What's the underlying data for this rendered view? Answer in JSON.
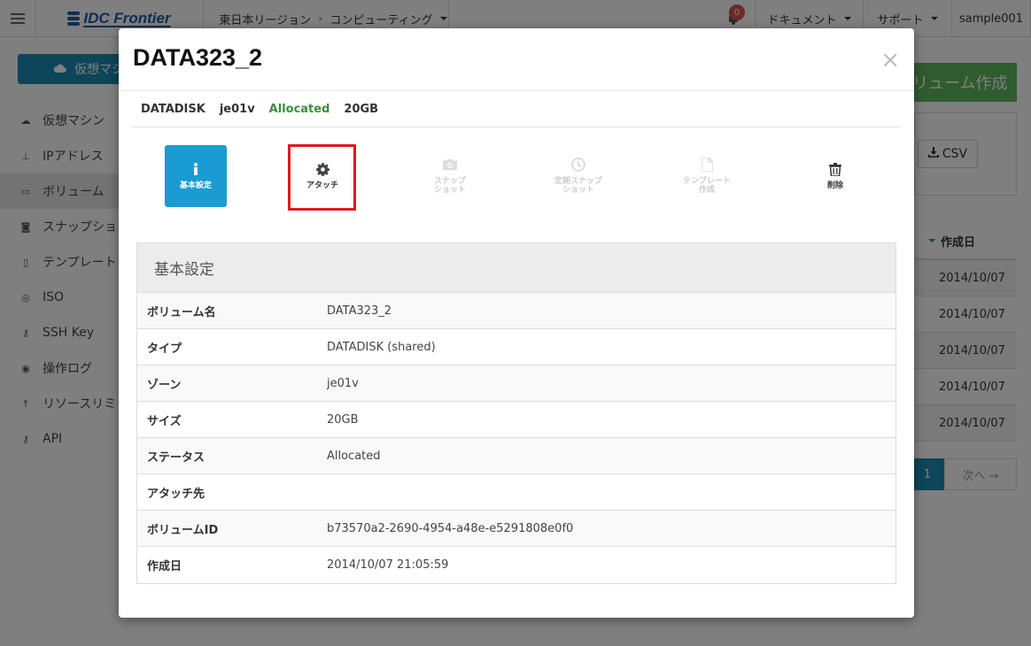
{
  "topbar": {
    "logo_text": "IDC Frontier",
    "region": "東日本リージョン",
    "region_sep": "›",
    "service": "コンピューティング",
    "notifications": "0",
    "docs": "ドキュメント",
    "support": "サポート",
    "user": "sample001"
  },
  "sidebar": {
    "vm_button": "仮想マシ",
    "items": [
      {
        "label": "仮想マシン",
        "icon": "cloud-icon"
      },
      {
        "label": "IPアドレス",
        "icon": "sitemap-icon"
      },
      {
        "label": "ボリューム",
        "icon": "hdd-icon"
      },
      {
        "label": "スナップショ",
        "icon": "camera-icon"
      },
      {
        "label": "テンプレート",
        "icon": "file-icon"
      },
      {
        "label": "ISO",
        "icon": "disc-icon"
      },
      {
        "label": "SSH Key",
        "icon": "key-icon"
      },
      {
        "label": "操作ログ",
        "icon": "eye-icon"
      },
      {
        "label": "リソースリミ",
        "icon": "arrow-up-icon"
      },
      {
        "label": "API",
        "icon": "key-icon"
      }
    ]
  },
  "background": {
    "create_button": "リューム作成",
    "csv_button": "CSV",
    "date_header": "作成日",
    "dates": [
      "2014/10/07",
      "2014/10/07",
      "2014/10/07",
      "2014/10/07",
      "2014/10/07"
    ],
    "page": "1",
    "next": "次へ →"
  },
  "modal": {
    "title": "DATA323_2",
    "close": "×",
    "summary": {
      "type": "DATADISK",
      "zone": "je01v",
      "status": "Allocated",
      "size": "20GB"
    },
    "actions": {
      "basic": "基本設定",
      "attach": "アタッチ",
      "snapshot": "スナップ\nショット",
      "scheduled_snapshot": "定期スナップ\nショット",
      "template": "テンプレート\n作成",
      "delete": "削除"
    },
    "panel_title": "基本設定",
    "details": [
      {
        "key": "ボリューム名",
        "value": "DATA323_2"
      },
      {
        "key": "タイプ",
        "value": "DATADISK (shared)"
      },
      {
        "key": "ゾーン",
        "value": "je01v"
      },
      {
        "key": "サイズ",
        "value": "20GB"
      },
      {
        "key": "ステータス",
        "value": "Allocated"
      },
      {
        "key": "アタッチ先",
        "value": ""
      },
      {
        "key": "ボリュームID",
        "value": "b73570a2-2690-4954-a48e-e5291808e0f0"
      },
      {
        "key": "作成日",
        "value": "2014/10/07 21:05:59"
      }
    ]
  },
  "colors": {
    "primary": "#1a9bd1",
    "success": "#5cb85c",
    "allocated_text": "#3c8d3c",
    "highlight": "#e0191f",
    "badge": "#d9534f"
  }
}
